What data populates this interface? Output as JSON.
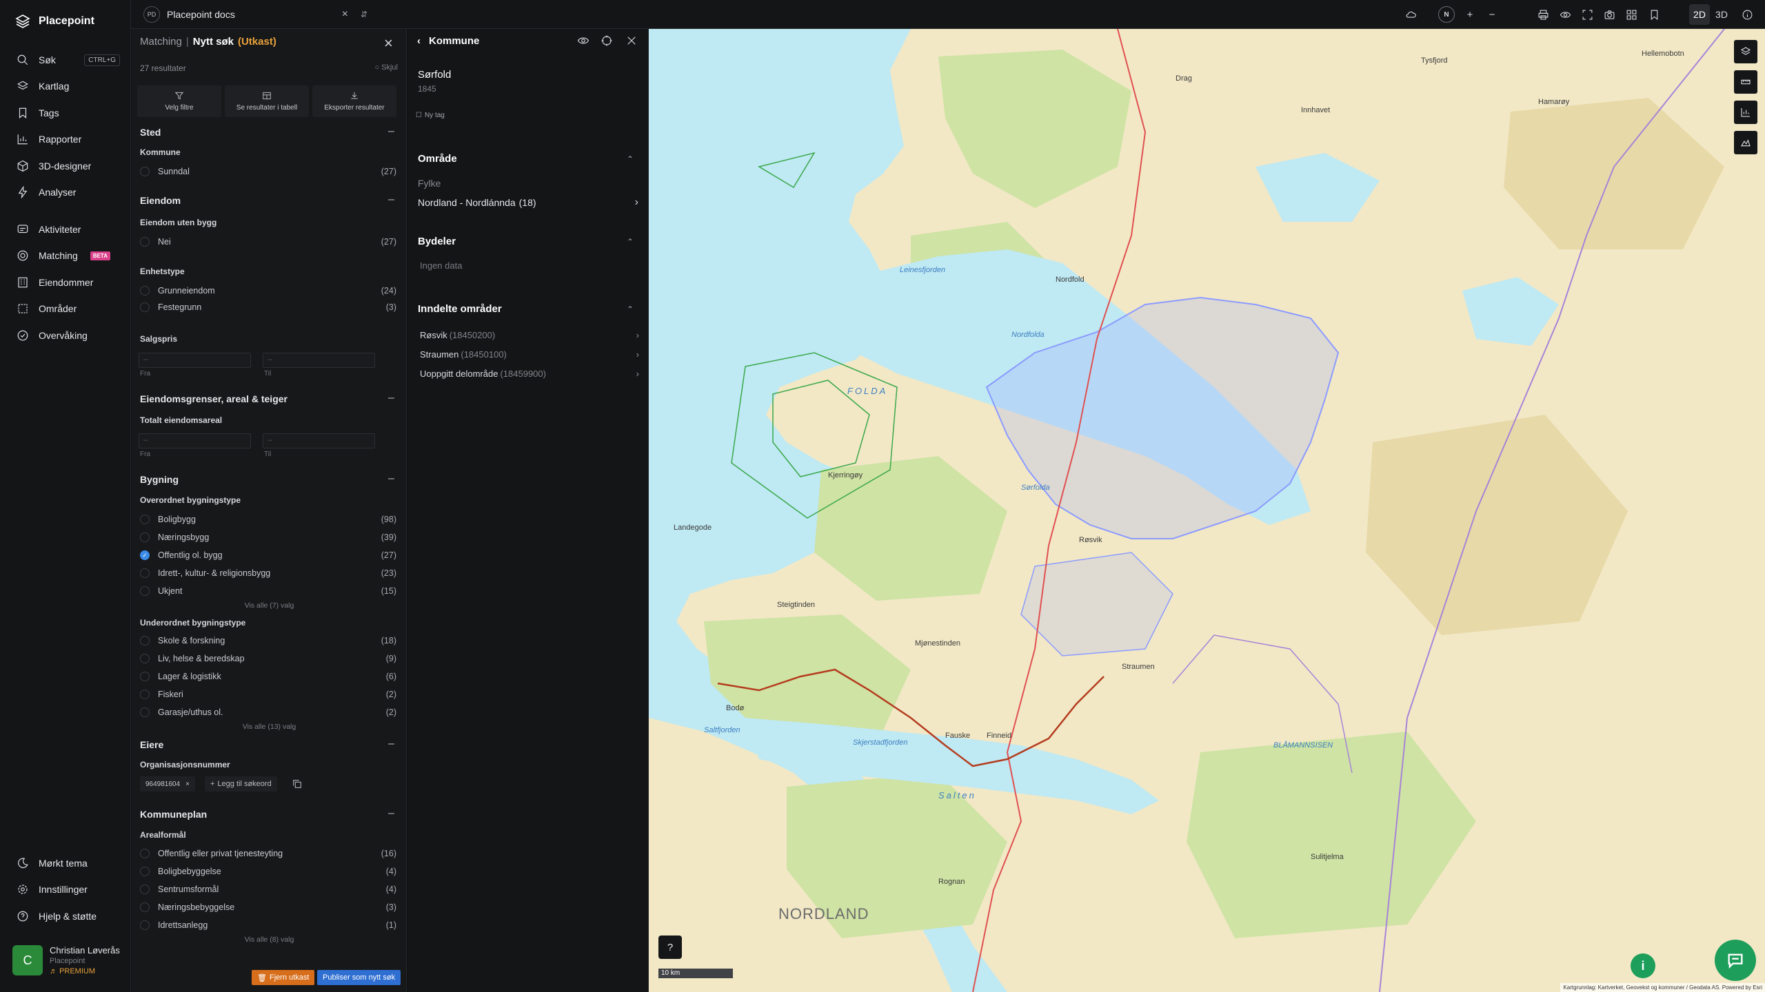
{
  "brand": {
    "name": "Placepoint"
  },
  "nav": {
    "search": {
      "label": "Søk",
      "shortcut": "CTRL+G"
    },
    "items": [
      {
        "label": "Kartlag"
      },
      {
        "label": "Tags"
      },
      {
        "label": "Rapporter"
      },
      {
        "label": "3D-designer"
      },
      {
        "label": "Analyser"
      },
      {
        "label": "Aktiviteter"
      },
      {
        "label": "Matching",
        "badge": "BETA"
      },
      {
        "label": "Eiendommer"
      },
      {
        "label": "Områder"
      },
      {
        "label": "Overvåking"
      }
    ],
    "bottom": [
      {
        "label": "Mørkt tema"
      },
      {
        "label": "Innstillinger"
      },
      {
        "label": "Hjelp & støtte"
      }
    ]
  },
  "user": {
    "initial": "C",
    "name": "Christian Løverås",
    "org": "Placepoint",
    "plan": "PREMIUM"
  },
  "project": {
    "badge": "PD",
    "name": "Placepoint docs"
  },
  "topbar": {
    "compass": "N",
    "view_2d": "2D",
    "view_3d": "3D"
  },
  "search_panel": {
    "crumb": "Matching",
    "title": "Nytt søk",
    "status": "(Utkast)",
    "results": "27 resultater",
    "hide": "Skjul",
    "actions": {
      "filter": "Velg filtre",
      "table": "Se resultater i tabell",
      "export": "Eksporter resultater"
    },
    "sections": {
      "sted": {
        "title": "Sted",
        "kommune_label": "Kommune",
        "options": [
          {
            "label": "Sunndal",
            "count": "(27)"
          }
        ]
      },
      "eiendom": {
        "title": "Eiendom",
        "uten_bygg_label": "Eiendom uten bygg",
        "uten_bygg": [
          {
            "label": "Nei",
            "count": "(27)"
          }
        ],
        "enhetstype_label": "Enhetstype",
        "enhetstype": [
          {
            "label": "Grunneiendom",
            "count": "(24)"
          },
          {
            "label": "Festegrunn",
            "count": "(3)"
          }
        ],
        "salgspris_label": "Salgspris",
        "from_ph": "--",
        "to_ph": "--",
        "from_label": "Fra",
        "to_label": "Til"
      },
      "grenser": {
        "title": "Eiendomsgrenser, areal & teiger",
        "areal_label": "Totalt eiendomsareal",
        "from_ph": "--",
        "to_ph": "--",
        "from_label": "Fra",
        "to_label": "Til"
      },
      "bygning": {
        "title": "Bygning",
        "overordnet_label": "Overordnet bygningstype",
        "overordnet": [
          {
            "label": "Boligbygg",
            "count": "(98)"
          },
          {
            "label": "Næringsbygg",
            "count": "(39)"
          },
          {
            "label": "Offentlig ol. bygg",
            "count": "(27)"
          },
          {
            "label": "Idrett-, kultur- & religionsbygg",
            "count": "(23)"
          },
          {
            "label": "Ukjent",
            "count": "(15)"
          }
        ],
        "overordnet_more": "Vis alle (7) valg",
        "underordnet_label": "Underordnet bygningstype",
        "underordnet": [
          {
            "label": "Skole & forskning",
            "count": "(18)"
          },
          {
            "label": "Liv, helse & beredskap",
            "count": "(9)"
          },
          {
            "label": "Lager & logistikk",
            "count": "(6)"
          },
          {
            "label": "Fiskeri",
            "count": "(2)"
          },
          {
            "label": "Garasje/uthus ol.",
            "count": "(2)"
          }
        ],
        "underordnet_more": "Vis alle (13) valg"
      },
      "eiere": {
        "title": "Eiere",
        "org_label": "Organisasjonsnummer",
        "chip": "964981604",
        "add": "Legg til søkeord"
      },
      "kommuneplan": {
        "title": "Kommuneplan",
        "areal_label": "Arealformål",
        "options": [
          {
            "label": "Offentlig eller privat tjenesteyting",
            "count": "(16)"
          },
          {
            "label": "Boligbebyggelse",
            "count": "(4)"
          },
          {
            "label": "Sentrumsformål",
            "count": "(4)"
          },
          {
            "label": "Næringsbebyggelse",
            "count": "(3)"
          },
          {
            "label": "Idrettsanlegg",
            "count": "(1)"
          }
        ],
        "more": "Vis alle (8) valg"
      }
    },
    "footer": {
      "remove": "Fjern utkast",
      "publish": "Publiser som nytt søk"
    }
  },
  "detail_panel": {
    "title": "Kommune",
    "name": "Sørfold",
    "code": "1845",
    "tag": "Ny tag",
    "omrade": {
      "title": "Område",
      "fylke_label": "Fylke",
      "fylke_value": "Nordland - Nordlánnda",
      "fylke_count": "(18)"
    },
    "bydeler": {
      "title": "Bydeler",
      "empty": "Ingen data"
    },
    "inndelte": {
      "title": "Inndelte områder",
      "items": [
        {
          "name": "Røsvik",
          "code": "(18450200)"
        },
        {
          "name": "Straumen",
          "code": "(18450100)"
        },
        {
          "name": "Uoppgitt delområde",
          "code": "(18459900)"
        }
      ]
    }
  },
  "map": {
    "scale": "10 km",
    "attribution": "Kartgrunnlag: Kartverket, Geovekst og kommuner / Geodata AS. Powered by Esri",
    "labels": {
      "nordland": "NORDLAND",
      "salten": "Salten",
      "folda": "FOLDA",
      "nordfolda": "Nordfolda",
      "sorfolda": "Sørfolda",
      "saltfjorden": "Saltfjorden",
      "skjerstadfjorden": "Skjerstadfjorden",
      "bodo": "Bodø",
      "fauske": "Fauske",
      "finneid": "Finneid",
      "rognan": "Rognan",
      "kjerringoy": "Kjerringøy",
      "landegode": "Landegode",
      "steigtinden": "Steigtinden",
      "straumen": "Straumen",
      "rosvik": "Røsvik",
      "leinesfjorden": "Leinesfjorden",
      "nordfold": "Nordfold",
      "blamannsisen": "BLÅMANNSISEN",
      "sulitjelma": "Sulitjelma",
      "kjerringoy_ph": "Mjønestinden",
      "inhavet": "Innhavet",
      "drag": "Drag",
      "hamaroy": "Hamarøy",
      "tysfjord": "Tysfjord",
      "hellemobotn": "Hellemobotn"
    }
  }
}
